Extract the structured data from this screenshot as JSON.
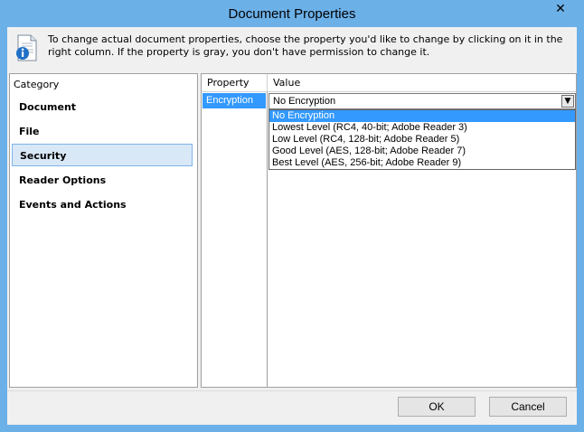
{
  "window": {
    "title": "Document Properties",
    "close_glyph": "✕"
  },
  "info": {
    "icon": "document-info-icon",
    "text": "To change actual document properties, choose the property you'd like to change by clicking on it in the right column. If the property is gray, you don't have permission to change it."
  },
  "categories": {
    "header": "Category",
    "items": [
      {
        "label": "Document"
      },
      {
        "label": "File"
      },
      {
        "label": "Security",
        "selected": true
      },
      {
        "label": "Reader Options"
      },
      {
        "label": "Events and Actions"
      }
    ]
  },
  "properties": {
    "col_property": "Property",
    "col_value": "Value",
    "row": {
      "name": "Encryption",
      "value": "No Encryption"
    },
    "dropdown_options": [
      "No Encryption",
      "Lowest Level (RC4, 40-bit; Adobe Reader 3)",
      "Low Level (RC4, 128-bit; Adobe Reader 5)",
      "Good Level (AES, 128-bit; Adobe Reader 7)",
      "Best Level (AES, 256-bit; Adobe Reader 9)"
    ]
  },
  "buttons": {
    "ok": "OK",
    "cancel": "Cancel"
  },
  "colors": {
    "frame": "#6cb0e8",
    "selection": "#3399ff"
  }
}
